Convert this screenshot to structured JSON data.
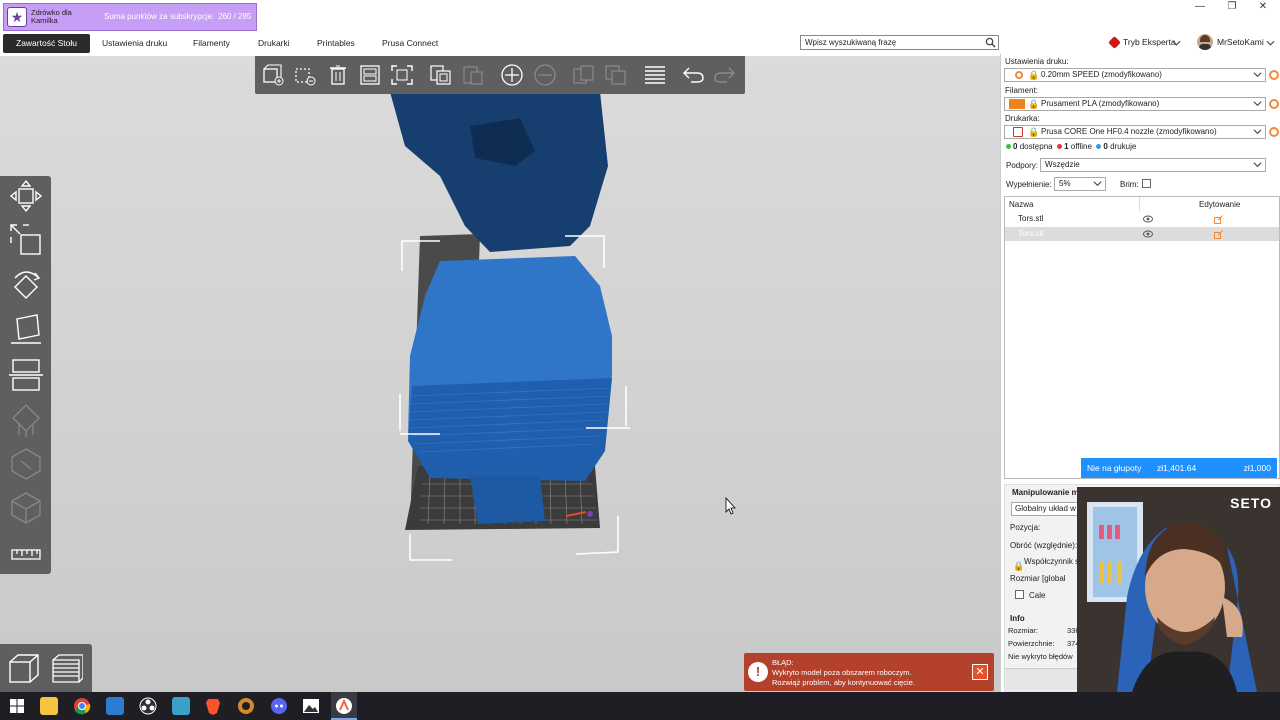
{
  "subscription": {
    "name": "Zdrówko dla Kamilka",
    "label": "Suma punktów za subskrypcje:",
    "count": "260 / 285"
  },
  "window_controls": [
    "—",
    "❐",
    "✕"
  ],
  "menu": {
    "tabs": [
      "Zawartość Stołu",
      "Ustawienia druku",
      "Filamenty",
      "Drukarki",
      "Printables",
      "Prusa Connect"
    ],
    "active_tab": "Zawartość Stołu"
  },
  "search": {
    "placeholder": "Wpisz wyszukiwaną frazę",
    "value": "Wpisz wyszukiwaną frazę"
  },
  "mode": {
    "label": "Tryb Eksperta",
    "color": "#cc1a1a"
  },
  "user": {
    "name": "MrSetoKami"
  },
  "right_panel": {
    "print_settings_label": "Ustawienia druku:",
    "print_settings_value": "0.20mm SPEED (zmodyfikowano)",
    "filament_label": "Filament:",
    "filament_value": "Prusament PLA (zmodyfikowano)",
    "filament_color": "#f0821e",
    "printer_label": "Drukarka:",
    "printer_value": "Prusa CORE One HF0.4 nozzle (zmodyfikowano)",
    "status": {
      "available_count": "0",
      "available_label": "dostępna",
      "offline_count": "1",
      "offline_label": "offline",
      "printing_count": "0",
      "printing_label": "drukuje"
    },
    "supports_label": "Podpory:",
    "supports_value": "Wszędzie",
    "infill_label": "Wypełnienie:",
    "infill_value": "5%",
    "brim_label": "Brim:",
    "brim_checked": false,
    "objects": {
      "col_name": "Nazwa",
      "col_edit": "Edytowanie",
      "rows": [
        {
          "name": "Tors.stl",
          "selected": false
        },
        {
          "name": "Tors.stl",
          "selected": true
        }
      ]
    },
    "price_bar": {
      "label": "Nie na głupoty",
      "amount": "zł1,401.64",
      "goal": "zł1,000"
    },
    "manipulation": {
      "title": "Manipulowanie m",
      "coord_system": "Globalny układ w",
      "position_label": "Pozycja:",
      "rotate_label": "Obróć (względnie):",
      "scale_label": "Współczynnik s",
      "size_label": "Rozmiar [global",
      "inches_label": "Cale",
      "info_title": "Info",
      "size_info_label": "Rozmiar:",
      "size_info_value": "336",
      "surface_label": "Powierzchnie:",
      "surface_value": "374",
      "errors_label": "Nie wykryto błędów"
    }
  },
  "error_toast": {
    "title": "BŁĄD:",
    "line1": "Wykryto model poza obszarem roboczym.",
    "line2": "Rozwiąż problem, aby kontynuować cięcie."
  },
  "webcam": {
    "tag": "SETO"
  },
  "colors": {
    "model_blue": "#2f76c9",
    "model_dark": "#163e6e",
    "toolbar_gray": "#5f5f5f",
    "accent_orange": "#f28a3c",
    "error_red": "#b3412b",
    "price_blue": "#1e90ff"
  },
  "icons": {
    "top_toolbar": [
      "add-object-icon",
      "delete-icon",
      "delete-all-icon",
      "arrange-icon",
      "split-icon",
      "copy-icon",
      "paste-icon",
      "instance-add-icon",
      "instance-remove-icon",
      "split-objects-icon",
      "split-parts-icon",
      "layers-icon",
      "undo-icon",
      "redo-icon"
    ],
    "left_toolbar": [
      "move-icon",
      "scale-icon",
      "rotate-icon",
      "place-on-face-icon",
      "cut-icon",
      "support-paint-icon",
      "seam-paint-icon",
      "mmu-paint-icon",
      "measure-icon"
    ],
    "taskbar": [
      "windows-icon",
      "explorer-icon",
      "chrome-icon",
      "app-icon",
      "obs-icon",
      "app2-icon",
      "brave-icon",
      "app3-icon",
      "discord-icon",
      "photos-icon",
      "prusaslicer-icon"
    ]
  }
}
